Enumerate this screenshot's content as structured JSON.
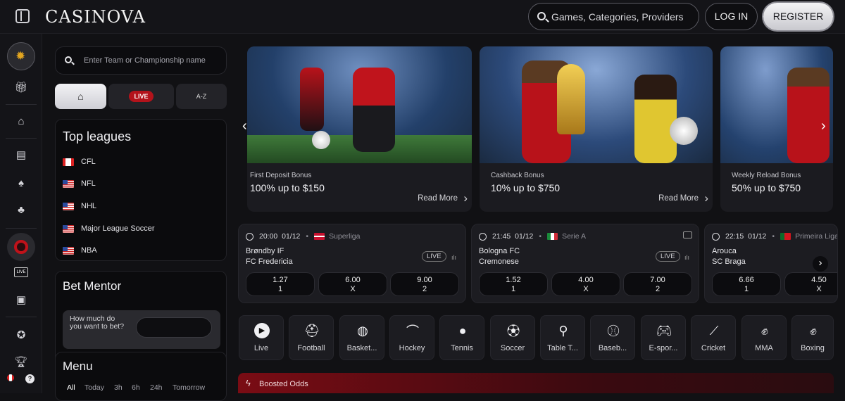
{
  "header": {
    "logo": "CASINOVA",
    "search_placeholder": "Games, Categories, Providers",
    "login": "LOG IN",
    "register": "REGISTER"
  },
  "rail": {
    "icons": [
      "sun-icon",
      "gift-icon",
      "casino-icon",
      "slot-machine-icon",
      "cards-icon",
      "clover-icon",
      "roulette-icon",
      "live-icon",
      "sports-tv-icon",
      "badge-icon",
      "trophy-icon"
    ],
    "live_label": "LIVE",
    "help_label": "?"
  },
  "left": {
    "search_placeholder": "Enter Team or Championship name",
    "segments": [
      "LIVE",
      "A-Z"
    ],
    "top_leagues": {
      "title": "Top leagues",
      "items": [
        {
          "name": "CFL",
          "flag": "ca"
        },
        {
          "name": "NFL",
          "flag": "us"
        },
        {
          "name": "NHL",
          "flag": "us"
        },
        {
          "name": "Major League Soccer",
          "flag": "us"
        },
        {
          "name": "NBA",
          "flag": "us"
        }
      ]
    },
    "bet_mentor": {
      "title": "Bet Mentor",
      "question": "How much do you want to bet?"
    },
    "menu": {
      "title": "Menu",
      "filters": [
        "All",
        "Today",
        "3h",
        "6h",
        "24h",
        "Tomorrow"
      ]
    }
  },
  "banners": [
    {
      "small": "First Deposit Bonus",
      "big": "100% up to $150",
      "link": "Read More"
    },
    {
      "small": "Cashback Bonus",
      "big": "10% up to $750",
      "link": "Read More"
    },
    {
      "small": "Weekly Reload Bonus",
      "big": "50% up to $750",
      "link": ""
    }
  ],
  "matches": [
    {
      "time": "20:00",
      "date": "01/12",
      "league": "Superliga",
      "home": "Brøndby IF",
      "away": "FC Fredericia",
      "live": "LIVE",
      "odds": [
        {
          "v": "1.27",
          "l": "1"
        },
        {
          "v": "6.00",
          "l": "X"
        },
        {
          "v": "9.00",
          "l": "2"
        }
      ]
    },
    {
      "time": "21:45",
      "date": "01/12",
      "league": "Serie A",
      "home": "Bologna FC",
      "away": "Cremonese",
      "live": "LIVE",
      "odds": [
        {
          "v": "1.52",
          "l": "1"
        },
        {
          "v": "4.00",
          "l": "X"
        },
        {
          "v": "7.00",
          "l": "2"
        }
      ]
    },
    {
      "time": "22:15",
      "date": "01/12",
      "league": "Primeira Liga",
      "home": "Arouca",
      "away": "SC Braga",
      "live": "",
      "odds": [
        {
          "v": "6.66",
          "l": "1"
        },
        {
          "v": "4.50",
          "l": "X"
        }
      ]
    }
  ],
  "sports": [
    "Live",
    "Football",
    "Basket...",
    "Hockey",
    "Tennis",
    "Soccer",
    "Table T...",
    "Baseb...",
    "E-spor...",
    "Cricket",
    "MMA",
    "Boxing"
  ],
  "boosted": "Boosted Odds",
  "colors": {
    "accent_red": "#b3131b",
    "gold": "#d9a520"
  }
}
